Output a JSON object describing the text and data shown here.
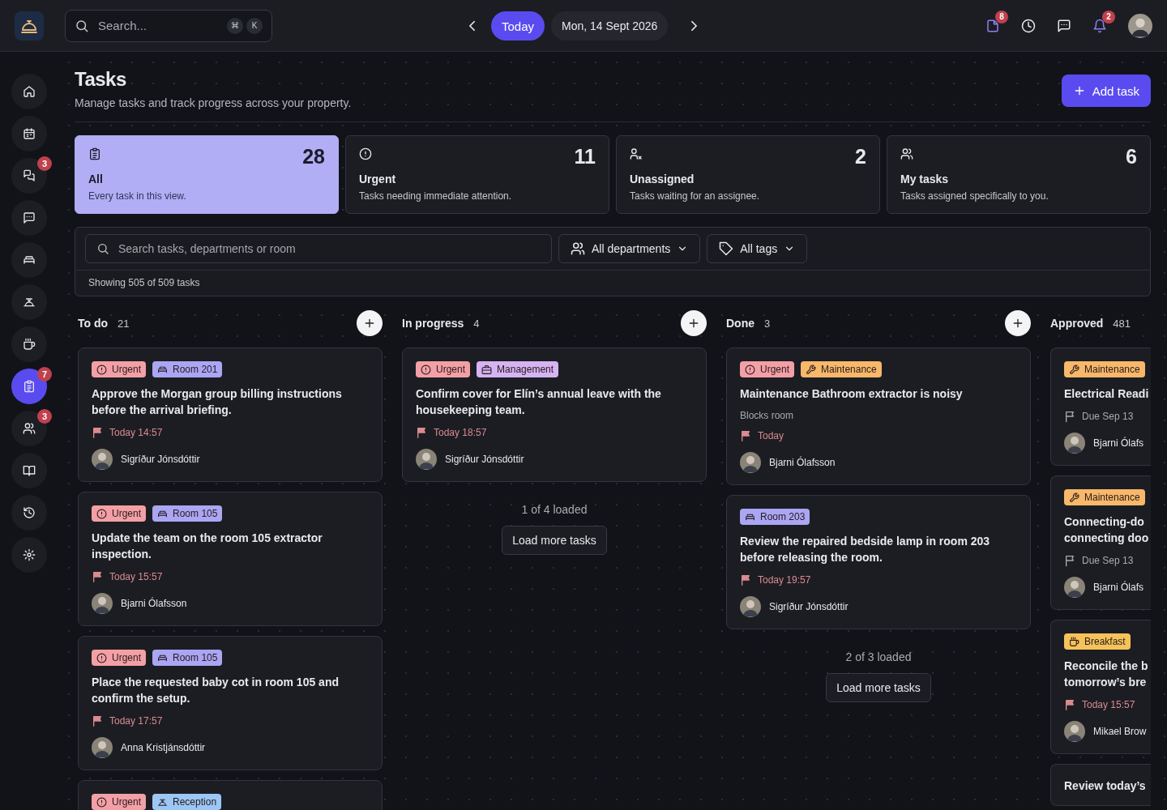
{
  "topbar": {
    "search": {
      "placeholder": "Search...",
      "keys": [
        "⌘",
        "K"
      ]
    },
    "today_button": "Today",
    "date": "Mon, 14 Sept 2026",
    "actions": [
      {
        "kind": "notes",
        "badge": "8",
        "active": true
      },
      {
        "kind": "clock",
        "active": false
      },
      {
        "kind": "chat",
        "active": false
      },
      {
        "kind": "bell",
        "badge": "2",
        "active": true
      }
    ]
  },
  "sidebar": {
    "items": [
      {
        "selected": false
      },
      {
        "selected": false
      },
      {
        "selected": false,
        "badge": "3"
      },
      {
        "selected": false
      },
      {
        "selected": false
      },
      {
        "selected": false
      },
      {
        "selected": false
      },
      {
        "selected": true,
        "badge": "7"
      },
      {
        "selected": false,
        "badge": "3"
      },
      {
        "selected": false
      },
      {
        "selected": false
      },
      {
        "selected": false
      }
    ]
  },
  "header": {
    "title": "Tasks",
    "subtitle": "Manage tasks and track progress across your property.",
    "add_button": "Add task"
  },
  "stats": [
    {
      "kind": "all",
      "count": "28",
      "label": "All",
      "description": "Every task in this view.",
      "selected": true
    },
    {
      "kind": "urgent",
      "count": "11",
      "label": "Urgent",
      "description": "Tasks needing immediate attention.",
      "selected": false
    },
    {
      "kind": "unassigned",
      "count": "2",
      "label": "Unassigned",
      "description": "Tasks waiting for an assignee.",
      "selected": false
    },
    {
      "kind": "mine",
      "count": "6",
      "label": "My tasks",
      "description": "Tasks assigned specifically to you.",
      "selected": false
    }
  ],
  "filters": {
    "search_placeholder": "Search tasks, departments or room",
    "departments": "All departments",
    "tags": "All tags",
    "summary": "Showing 505 of 509 tasks"
  },
  "columns": [
    {
      "title": "To do",
      "count": "21",
      "add_button": true,
      "cut": false,
      "cards": [
        {
          "tags": [
            {
              "kind": "urgent",
              "label": "Urgent"
            },
            {
              "kind": "room",
              "label": "Room 201"
            }
          ],
          "title": "Approve the Morgan group billing instructions before the arrival briefing.",
          "due": {
            "kind": "today",
            "text": "Today 14:57"
          },
          "assignee": "Sigríður Jónsdóttir"
        },
        {
          "tags": [
            {
              "kind": "urgent",
              "label": "Urgent"
            },
            {
              "kind": "room",
              "label": "Room 105"
            }
          ],
          "title": "Update the team on the room 105 extractor inspection.",
          "due": {
            "kind": "today",
            "text": "Today 15:57"
          },
          "assignee": "Bjarni Ólafsson"
        },
        {
          "tags": [
            {
              "kind": "urgent",
              "label": "Urgent"
            },
            {
              "kind": "room",
              "label": "Room 105"
            }
          ],
          "title": "Place the requested baby cot in room 105 and confirm the setup.",
          "due": {
            "kind": "today",
            "text": "Today 17:57"
          },
          "assignee": "Anna Kristjánsdóttir"
        },
        {
          "tags": [
            {
              "kind": "urgent",
              "label": "Urgent"
            },
            {
              "kind": "reception",
              "label": "Reception"
            }
          ]
        }
      ]
    },
    {
      "title": "In progress",
      "count": "4",
      "add_button": true,
      "cut": false,
      "cards": [
        {
          "tags": [
            {
              "kind": "urgent",
              "label": "Urgent"
            },
            {
              "kind": "management",
              "label": "Management"
            }
          ],
          "title": "Confirm cover for Elín’s annual leave with the housekeeping team.",
          "due": {
            "kind": "today",
            "text": "Today 18:57"
          },
          "assignee": "Sigríður Jónsdóttir"
        }
      ],
      "loaded": "1 of 4 loaded",
      "load_more": "Load more tasks"
    },
    {
      "title": "Done",
      "count": "3",
      "add_button": true,
      "cut": false,
      "cards": [
        {
          "tags": [
            {
              "kind": "urgent",
              "label": "Urgent"
            },
            {
              "kind": "maintenance",
              "label": "Maintenance"
            }
          ],
          "title": "Maintenance Bathroom extractor is noisy",
          "note": "Blocks room",
          "due": {
            "kind": "today",
            "text": "Today"
          },
          "assignee": "Bjarni Ólafsson"
        },
        {
          "tags": [
            {
              "kind": "room",
              "label": "Room 203"
            }
          ],
          "title": "Review the repaired bedside lamp in room 203 before releasing the room.",
          "due": {
            "kind": "today",
            "text": "Today 19:57"
          },
          "assignee": "Sigríður Jónsdóttir"
        }
      ],
      "loaded": "2 of 3 loaded",
      "load_more": "Load more tasks"
    },
    {
      "title": "Approved",
      "count": "481",
      "add_button": false,
      "cut": true,
      "cards": [
        {
          "tags": [
            {
              "kind": "maintenance",
              "label": "Maintenance"
            }
          ],
          "title": "Electrical Readi",
          "due": {
            "kind": "upcoming",
            "text": "Due Sep 13"
          },
          "assignee": "Bjarni Ólafs"
        },
        {
          "tags": [
            {
              "kind": "maintenance",
              "label": "Maintenance"
            }
          ],
          "title": "Connecting-do\nconnecting doo",
          "due": {
            "kind": "upcoming",
            "text": "Due Sep 13"
          },
          "assignee": "Bjarni Ólafs"
        },
        {
          "tags": [
            {
              "kind": "breakfast",
              "label": "Breakfast"
            }
          ],
          "title": "Reconcile the b\ntomorrow’s bre",
          "due": {
            "kind": "today",
            "text": "Today 15:57"
          },
          "assignee": "Mikael Brow"
        },
        {
          "title": "Review today’s"
        }
      ]
    }
  ]
}
